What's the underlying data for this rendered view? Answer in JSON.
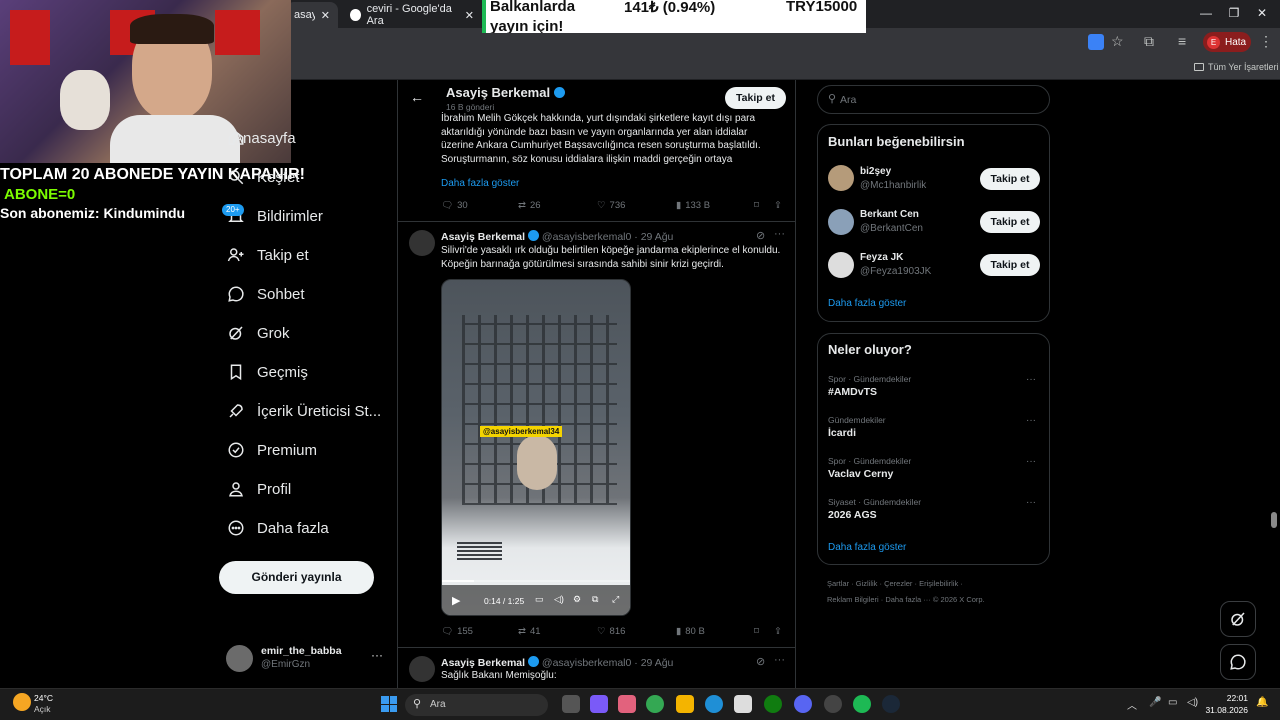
{
  "browser": {
    "tabs": [
      {
        "label": "asayişb"
      },
      {
        "label": "ceviri - Google'da Ara"
      }
    ],
    "bookmarks_label": "Tüm Yer İşaretleri",
    "profile_label": "Hata",
    "profile_initial": "E"
  },
  "ticker": {
    "line1_left": "Balkanlarda",
    "line1_mid": "141₺ (0.94%)",
    "line1_right": "TRY15000",
    "line2": "yayın için!"
  },
  "stream_overlay": {
    "line1": "TOPLAM 20 ABONEDE YAYIN KAPANIR!",
    "line2": "ABONE=0",
    "line3": "Son abonemiz: Kindumindu"
  },
  "sidebar": {
    "items": [
      {
        "label": "Anasayfa",
        "icon": "home-icon"
      },
      {
        "label": "Keşfet",
        "icon": "search-icon"
      },
      {
        "label": "Bildirimler",
        "icon": "bell-icon",
        "badge": "20+"
      },
      {
        "label": "Takip et",
        "icon": "person-add-icon"
      },
      {
        "label": "Sohbet",
        "icon": "chat-icon"
      },
      {
        "label": "Grok",
        "icon": "grok-icon"
      },
      {
        "label": "Geçmiş",
        "icon": "bookmark-icon"
      },
      {
        "label": "İçerik Üreticisi St...",
        "icon": "rocket-icon"
      },
      {
        "label": "Premium",
        "icon": "verified-icon"
      },
      {
        "label": "Profil",
        "icon": "person-icon"
      },
      {
        "label": "Daha fazla",
        "icon": "more-circle-icon"
      }
    ],
    "post_button": "Gönderi yayınla",
    "account": {
      "name": "emir_the_babba",
      "handle": "@EmirGzn"
    }
  },
  "profile_header": {
    "name": "Asayiş Berkemal",
    "subtitle": "16 B gönderi",
    "follow_label": "Takip et"
  },
  "tweets": [
    {
      "text": "İbrahim Melih Gökçek hakkında, yurt dışındaki şirketlere kayıt dışı para aktarıldığı yönünde bazı basın ve yayın organlarında yer alan iddialar üzerine Ankara Cumhuriyet Başsavcılığınca resen soruşturma başlatıldı. Soruşturmanın, söz konusu iddialara ilişkin maddi gerçeğin ortaya",
      "show_more": "Daha fazla göster",
      "replies": "30",
      "retweets": "26",
      "likes": "736",
      "views": "133 B"
    },
    {
      "name": "Asayiş Berkemal",
      "handle": "@asayisberkemal0",
      "date": "· 29 Ağu",
      "text": "Silivri'de yasaklı ırk olduğu belirtilen köpeğe jandarma ekiplerince el konuldu. Köpeğin barınağa götürülmesi sırasında sahibi sinir krizi geçirdi.",
      "video_tag": "@asayisberkemal34",
      "video_time": "0:14 / 1:25",
      "replies": "155",
      "retweets": "41",
      "likes": "816",
      "views": "80 B"
    },
    {
      "name": "Asayiş Berkemal",
      "handle": "@asayisberkemal0",
      "date": "· 29 Ağu",
      "text": "Sağlık Bakanı Memişoğlu:"
    }
  ],
  "right": {
    "search_placeholder": "Ara",
    "suggest_title": "Bunları beğenebilirsin",
    "suggestions": [
      {
        "name": "bi2şey",
        "handle": "@Mc1hanbirlik",
        "button": "Takip et"
      },
      {
        "name": "Berkant Cen",
        "handle": "@BerkantCen",
        "button": "Takip et"
      },
      {
        "name": "Feyza JK",
        "handle": "@Feyza1903JK",
        "button": "Takip et"
      }
    ],
    "suggest_more": "Daha fazla göster",
    "trends_title": "Neler oluyor?",
    "trends": [
      {
        "category": "Spor · Gündemdekiler",
        "name": "#AMDvTS"
      },
      {
        "category": "Gündemdekiler",
        "name": "İcardi"
      },
      {
        "category": "Spor · Gündemdekiler",
        "name": "Vaclav Cerny"
      },
      {
        "category": "Siyaset · Gündemdekiler",
        "name": "2026 AGS"
      }
    ],
    "trends_more": "Daha fazla göster",
    "footer_line1": "Şartlar · Gizlilik · Çerezler · Erişilebilirlik ·",
    "footer_line2": "Reklam Bilgileri · Daha fazla ··· © 2026 X Corp."
  },
  "taskbar": {
    "weather_temp": "24°C",
    "weather_desc": "Açık",
    "search_placeholder": "Ara",
    "time": "22:01",
    "date": "31.08.2026"
  }
}
